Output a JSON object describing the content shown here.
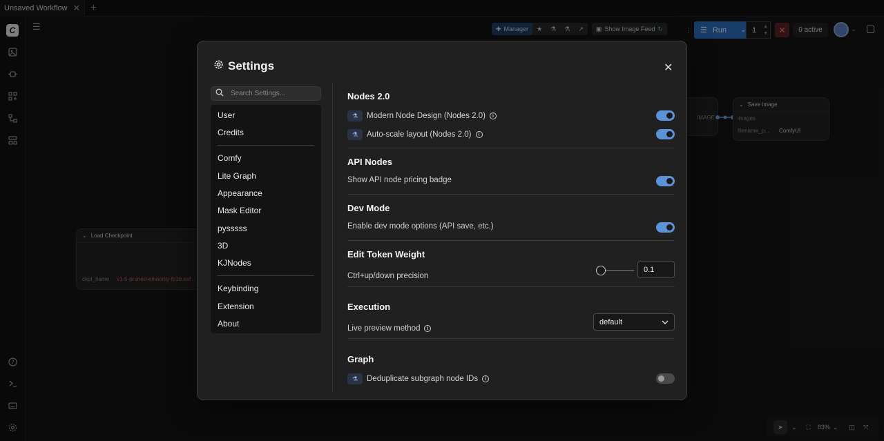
{
  "tab": {
    "title": "Unsaved Workflow",
    "close": "✕",
    "add": "+"
  },
  "canvas": {
    "load_checkpoint": {
      "title": "Load Checkpoint",
      "field_label": "ckpt_name",
      "field_value": "v1-5-pruned-emaonly-fp16.saf..."
    },
    "save_image": {
      "title": "Save Image",
      "input": "images",
      "field_label": "filename_p...",
      "field_value": "ComfyUI"
    },
    "edge_label": "IMAGE"
  },
  "toolbar": {
    "manager": "Manager",
    "show_image_feed": "Show Image Feed",
    "run": "Run",
    "batch_count": "1",
    "active": "0 active"
  },
  "bottom": {
    "zoom": "83%"
  },
  "dialog": {
    "title": "Settings",
    "close": "✕",
    "search_placeholder": "Search Settings...",
    "categories_group1": [
      "User",
      "Credits"
    ],
    "categories_group2": [
      "Comfy",
      "Lite Graph",
      "Appearance",
      "Mask Editor",
      "pysssss",
      "3D",
      "KJNodes"
    ],
    "categories_group3": [
      "Keybinding",
      "Extension",
      "About"
    ],
    "sections": {
      "nodes2": {
        "title": "Nodes 2.0",
        "modern_node_design": "Modern Node Design (Nodes 2.0)",
        "modern_node_design_on": true,
        "auto_scale": "Auto-scale layout (Nodes 2.0)",
        "auto_scale_on": true
      },
      "api_nodes": {
        "title": "API Nodes",
        "pricing_badge": "Show API node pricing badge",
        "pricing_badge_on": true
      },
      "dev_mode": {
        "title": "Dev Mode",
        "enable": "Enable dev mode options (API save, etc.)",
        "enable_on": true
      },
      "token_weight": {
        "title": "Edit Token Weight",
        "precision": "Ctrl+up/down precision",
        "value": "0.1",
        "slider_fraction": 0.1
      },
      "execution": {
        "title": "Execution",
        "preview": "Live preview method",
        "preview_value": "default"
      },
      "graph": {
        "title": "Graph",
        "dedupe": "Deduplicate subgraph node IDs",
        "dedupe_on": false
      }
    }
  },
  "colors": {
    "accent": "#5b93d6",
    "run": "#2f6fc0",
    "stop": "#5c2226"
  }
}
